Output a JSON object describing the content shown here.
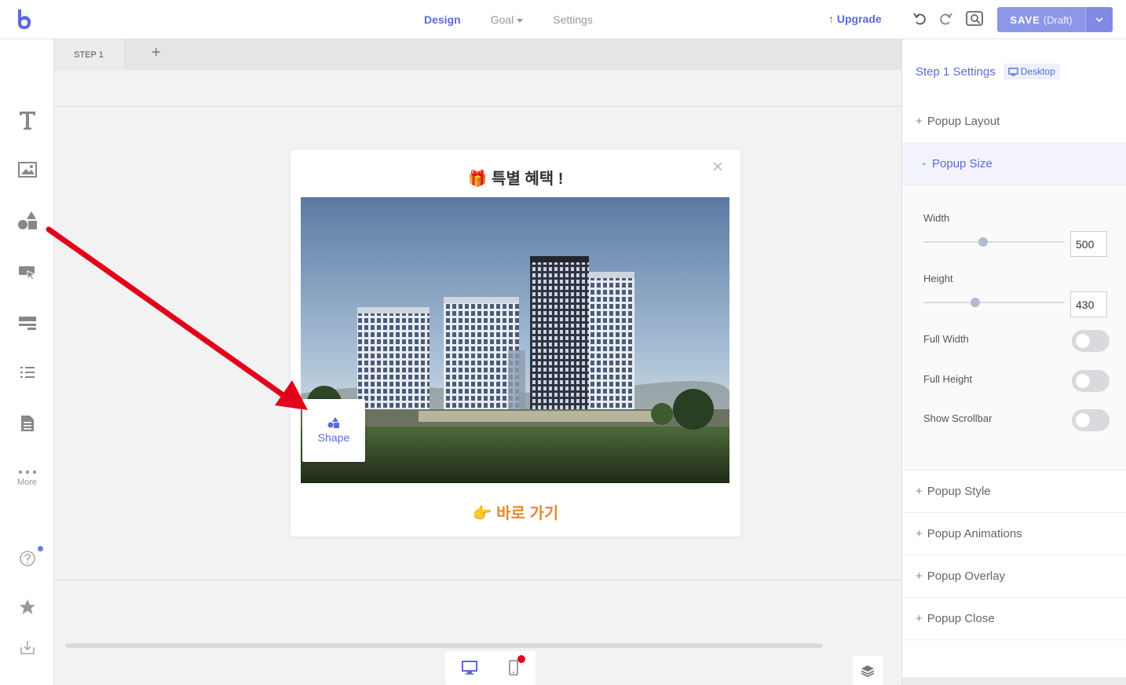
{
  "topbar": {
    "nav": {
      "design": "Design",
      "goal": "Goal",
      "settings": "Settings"
    },
    "upgrade": "Upgrade",
    "save": {
      "label": "SAVE",
      "status": "(Draft)"
    }
  },
  "lefttoolbar": {
    "more_label": "More"
  },
  "canvas": {
    "step_tab": "STEP 1",
    "add_step": "+",
    "popup": {
      "title": "특별 혜택 !",
      "close": "×",
      "cta": "바로 가기"
    },
    "drag_item_label": "Shape"
  },
  "panel": {
    "title": "Step 1 Settings",
    "device_badge": "Desktop",
    "sections": {
      "layout": "Popup Layout",
      "size": "Popup Size",
      "style": "Popup Style",
      "animations": "Popup Animations",
      "overlay": "Popup Overlay",
      "close": "Popup Close"
    },
    "size": {
      "width_label": "Width",
      "width_value": "500",
      "height_label": "Height",
      "height_value": "430",
      "full_width": "Full Width",
      "full_height": "Full Height",
      "show_scrollbar": "Show Scrollbar"
    }
  },
  "colors": {
    "accent": "#5b6ad8",
    "cta": "#e48b2a",
    "arrow": "#e3001b"
  }
}
